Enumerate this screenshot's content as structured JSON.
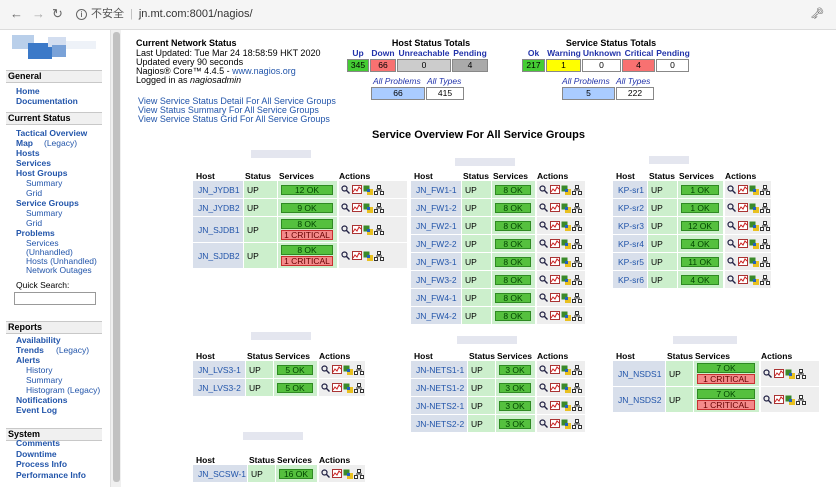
{
  "browser": {
    "secure_text": "不安全",
    "url": "jn.mt.com:8001/nagios/"
  },
  "sidebar": {
    "sections": [
      {
        "title": "General",
        "items": [
          {
            "label": "Home"
          },
          {
            "label": "Documentation"
          }
        ]
      },
      {
        "title": "Current Status",
        "items": [
          {
            "label": "Tactical Overview"
          },
          {
            "label": "Map"
          },
          {
            "label": "(Legacy)"
          },
          {
            "label": "Hosts"
          },
          {
            "label": "Services"
          },
          {
            "label": "Host Groups"
          },
          {
            "label": "Summary"
          },
          {
            "label": "Grid"
          },
          {
            "label": "Service Groups"
          },
          {
            "label": "Summary"
          },
          {
            "label": "Grid"
          },
          {
            "label": "Problems"
          },
          {
            "label": "Services"
          },
          {
            "label": "(Unhandled)"
          },
          {
            "label": "Hosts (Unhandled)"
          },
          {
            "label": "Network Outages"
          }
        ]
      },
      {
        "title": "Reports",
        "items": [
          {
            "label": "Availability"
          },
          {
            "label": "Trends"
          },
          {
            "label": "(Legacy)"
          },
          {
            "label": "Alerts"
          },
          {
            "label": "History"
          },
          {
            "label": "Summary"
          },
          {
            "label": "Histogram (Legacy)"
          },
          {
            "label": "Notifications"
          },
          {
            "label": "Event Log"
          }
        ]
      },
      {
        "title": "System",
        "items": [
          {
            "label": "Comments"
          },
          {
            "label": "Downtime"
          },
          {
            "label": "Process Info"
          },
          {
            "label": "Performance Info"
          }
        ]
      }
    ],
    "quick_search_label": "Quick Search:"
  },
  "status": {
    "title": "Current Network Status",
    "updated": "Last Updated: Tue Mar 24 18:58:59 HKT 2020",
    "every": "Updated every 90 seconds",
    "core_prefix": "Nagios® Core™ 4.4.5 - ",
    "core_link": "www.nagios.org",
    "logged_prefix": "Logged in as ",
    "logged_user": "nagiosadmin",
    "links": [
      "View Service Status Detail For All Service Groups",
      "View Status Summary For All Service Groups",
      "View Service Status Grid For All Service Groups"
    ]
  },
  "host_totals": {
    "title": "Host Status Totals",
    "headers": [
      "Up",
      "Down",
      "Unreachable",
      "Pending"
    ],
    "values": [
      "345",
      "66",
      "0",
      "4"
    ],
    "all_problems_label": "All Problems",
    "all_types_label": "All Types",
    "all_problems": "66",
    "all_types": "415"
  },
  "service_totals": {
    "title": "Service Status Totals",
    "headers": [
      "Ok",
      "Warning",
      "Unknown",
      "Critical",
      "Pending"
    ],
    "values": [
      "217",
      "1",
      "0",
      "4",
      "0"
    ],
    "all_problems_label": "All Problems",
    "all_types_label": "All Types",
    "all_problems": "5",
    "all_types": "222"
  },
  "overview": {
    "title": "Service Overview For All Service Groups",
    "col_host": "Host",
    "col_status": "Status",
    "col_services": "Services",
    "col_actions": "Actions",
    "groups": [
      {
        "rows": [
          {
            "host": "JN_JYDB1",
            "status": "UP",
            "services": [
              {
                "text": "12 OK",
                "state": "ok"
              }
            ]
          },
          {
            "host": "JN_JYDB2",
            "status": "UP",
            "services": [
              {
                "text": "9 OK",
                "state": "ok"
              }
            ]
          },
          {
            "host": "JN_SJDB1",
            "status": "UP",
            "services": [
              {
                "text": "8 OK",
                "state": "ok"
              },
              {
                "text": "1 CRITICAL",
                "state": "cr"
              }
            ]
          },
          {
            "host": "JN_SJDB2",
            "status": "UP",
            "services": [
              {
                "text": "8 OK",
                "state": "ok"
              },
              {
                "text": "1 CRITICAL",
                "state": "cr"
              }
            ]
          }
        ]
      },
      {
        "rows": [
          {
            "host": "JN_FW1-1",
            "status": "UP",
            "services": [
              {
                "text": "8 OK",
                "state": "ok"
              }
            ]
          },
          {
            "host": "JN_FW1-2",
            "status": "UP",
            "services": [
              {
                "text": "8 OK",
                "state": "ok"
              }
            ]
          },
          {
            "host": "JN_FW2-1",
            "status": "UP",
            "services": [
              {
                "text": "8 OK",
                "state": "ok"
              }
            ]
          },
          {
            "host": "JN_FW2-2",
            "status": "UP",
            "services": [
              {
                "text": "8 OK",
                "state": "ok"
              }
            ]
          },
          {
            "host": "JN_FW3-1",
            "status": "UP",
            "services": [
              {
                "text": "8 OK",
                "state": "ok"
              }
            ]
          },
          {
            "host": "JN_FW3-2",
            "status": "UP",
            "services": [
              {
                "text": "8 OK",
                "state": "ok"
              }
            ]
          },
          {
            "host": "JN_FW4-1",
            "status": "UP",
            "services": [
              {
                "text": "8 OK",
                "state": "ok"
              }
            ]
          },
          {
            "host": "JN_FW4-2",
            "status": "UP",
            "services": [
              {
                "text": "8 OK",
                "state": "ok"
              }
            ]
          }
        ]
      },
      {
        "rows": [
          {
            "host": "KP-sr1",
            "status": "UP",
            "services": [
              {
                "text": "1 OK",
                "state": "ok"
              }
            ]
          },
          {
            "host": "KP-sr2",
            "status": "UP",
            "services": [
              {
                "text": "1 OK",
                "state": "ok"
              }
            ]
          },
          {
            "host": "KP-sr3",
            "status": "UP",
            "services": [
              {
                "text": "12 OK",
                "state": "ok"
              }
            ]
          },
          {
            "host": "KP-sr4",
            "status": "UP",
            "services": [
              {
                "text": "4 OK",
                "state": "ok"
              }
            ]
          },
          {
            "host": "KP-sr5",
            "status": "UP",
            "services": [
              {
                "text": "11 OK",
                "state": "ok"
              }
            ]
          },
          {
            "host": "KP-sr6",
            "status": "UP",
            "services": [
              {
                "text": "4 OK",
                "state": "ok"
              }
            ]
          }
        ]
      },
      {
        "rows": [
          {
            "host": "JN_LVS3-1",
            "status": "UP",
            "services": [
              {
                "text": "5 OK",
                "state": "ok"
              }
            ]
          },
          {
            "host": "JN_LVS3-2",
            "status": "UP",
            "services": [
              {
                "text": "5 OK",
                "state": "ok"
              }
            ]
          }
        ]
      },
      {
        "rows": [
          {
            "host": "JN-NETS1-1",
            "status": "UP",
            "services": [
              {
                "text": "3 OK",
                "state": "ok"
              }
            ]
          },
          {
            "host": "JN-NETS1-2",
            "status": "UP",
            "services": [
              {
                "text": "3 OK",
                "state": "ok"
              }
            ]
          },
          {
            "host": "JN-NETS2-1",
            "status": "UP",
            "services": [
              {
                "text": "3 OK",
                "state": "ok"
              }
            ]
          },
          {
            "host": "JN-NETS2-2",
            "status": "UP",
            "services": [
              {
                "text": "3 OK",
                "state": "ok"
              }
            ]
          }
        ]
      },
      {
        "rows": [
          {
            "host": "JN_NSDS1",
            "status": "UP",
            "services": [
              {
                "text": "7 OK",
                "state": "ok"
              },
              {
                "text": "1 CRITICAL",
                "state": "cr"
              }
            ]
          },
          {
            "host": "JN_NSDS2",
            "status": "UP",
            "services": [
              {
                "text": "7 OK",
                "state": "ok"
              },
              {
                "text": "1 CRITICAL",
                "state": "cr"
              }
            ]
          }
        ]
      },
      {
        "rows": [
          {
            "host": "JN_SCSW-1",
            "status": "UP",
            "services": [
              {
                "text": "16 OK",
                "state": "ok"
              }
            ]
          }
        ]
      }
    ]
  },
  "colors": {
    "ok": "#55c03e",
    "critical": "#f48a8a",
    "host_bg": "#d8dfeb",
    "status_bg": "#ccefcc"
  }
}
